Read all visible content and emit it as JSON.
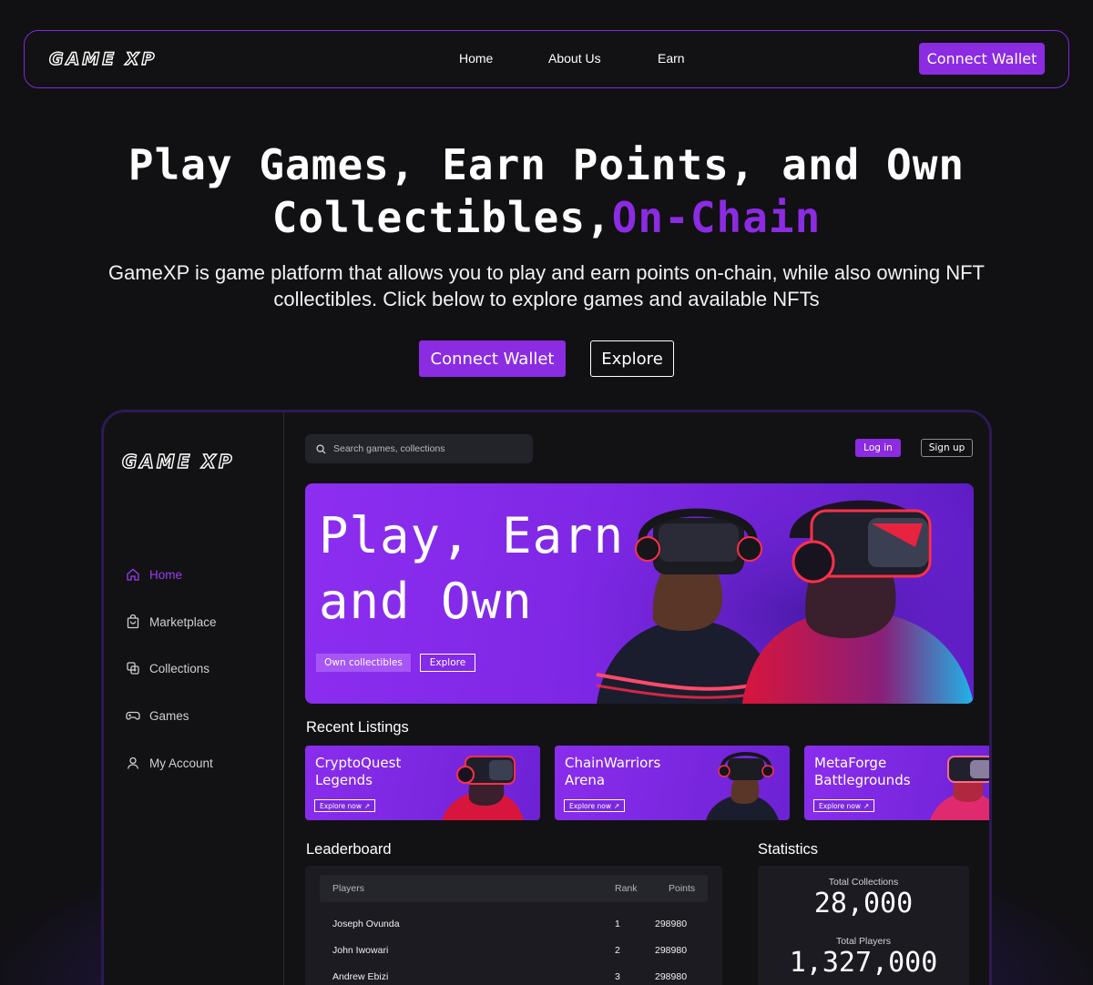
{
  "nav": {
    "logo": "GAME XP",
    "links": [
      "Home",
      "About Us",
      "Earn"
    ],
    "connect_label": "Connect Wallet"
  },
  "hero": {
    "title_line1": "Play Games, Earn Points, and Own",
    "title_line2": "Collectibles,",
    "title_accent": "On-Chain",
    "subtitle": "GameXP is game platform that allows you to play and earn points on-chain, while also owning NFT collectibles. Click below to explore games and available NFTs",
    "connect_label": "Connect Wallet",
    "explore_label": "Explore"
  },
  "app": {
    "logo": "GAME XP",
    "sidebar": {
      "items": [
        {
          "label": "Home",
          "icon": "home-icon",
          "active": true
        },
        {
          "label": "Marketplace",
          "icon": "bag-icon",
          "active": false
        },
        {
          "label": "Collections",
          "icon": "collections-icon",
          "active": false
        },
        {
          "label": "Games",
          "icon": "gamepad-icon",
          "active": false
        },
        {
          "label": "My Account",
          "icon": "user-icon",
          "active": false
        }
      ]
    },
    "search": {
      "placeholder": "Search games, collections"
    },
    "login_label": "Log in",
    "signup_label": "Sign up",
    "banner": {
      "title_line1": "Play, Earn",
      "title_line2": "and Own",
      "primary_label": "Own collectibles",
      "secondary_label": "Explore"
    },
    "recent_listings": {
      "title": "Recent Listings",
      "items": [
        {
          "title": "CryptoQuest\nLegends",
          "button": "Explore now"
        },
        {
          "title": "ChainWarriors\nArena",
          "button": "Explore now"
        },
        {
          "title": "MetaForge\nBattlegrounds",
          "button": "Explore now"
        }
      ]
    },
    "leaderboard": {
      "title": "Leaderboard",
      "columns": [
        "Players",
        "Rank",
        "Points"
      ],
      "rows": [
        {
          "player": "Joseph Ovunda",
          "rank": "1",
          "points": "298980"
        },
        {
          "player": "John Iwowari",
          "rank": "2",
          "points": "298980"
        },
        {
          "player": "Andrew Ebizi",
          "rank": "3",
          "points": "298980"
        }
      ]
    },
    "statistics": {
      "title": "Statistics",
      "total_collections_label": "Total Collections",
      "total_collections_value": "28,000",
      "total_players_label": "Total Players",
      "total_players_value": "1,327,000"
    }
  },
  "colors": {
    "accent": "#8b2be2",
    "background": "#111012",
    "border_glow": "#7c2bdc"
  }
}
